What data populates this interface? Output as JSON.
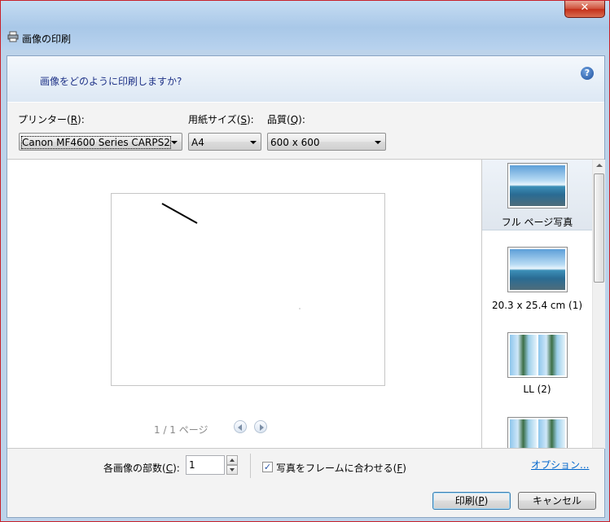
{
  "window": {
    "title": "画像の印刷",
    "close_glyph": "✕"
  },
  "header": {
    "question": "画像をどのように印刷しますか?"
  },
  "controls": {
    "printer_label_pre": "プリンター(",
    "printer_label_key": "R",
    "printer_label_post": "):",
    "printer_value": "Canon MF4600 Series CARPS2",
    "paper_label_pre": "用紙サイズ(",
    "paper_label_key": "S",
    "paper_label_post": "):",
    "paper_value": "A4",
    "quality_label_pre": "品質(",
    "quality_label_key": "Q",
    "quality_label_post": "):",
    "quality_value": "600 x 600",
    "help_glyph": "?"
  },
  "preview": {
    "pager_text": "1 / 1 ページ"
  },
  "layouts": [
    {
      "label": "フル ページ写真",
      "selected": true
    },
    {
      "label": "20.3 x 25.4 cm (1)",
      "selected": false
    },
    {
      "label": "LL (2)",
      "selected": false
    }
  ],
  "footer": {
    "copies_label_pre": "各画像の部数(",
    "copies_label_key": "C",
    "copies_label_post": "):",
    "copies_value": "1",
    "fit_label_pre": "写真をフレームに合わせる(",
    "fit_label_key": "F",
    "fit_label_post": ")",
    "fit_checked": true,
    "options_link": "オプション...",
    "print_label_pre": "印刷(",
    "print_label_key": "P",
    "print_label_post": ")",
    "cancel_label": "キャンセル"
  }
}
